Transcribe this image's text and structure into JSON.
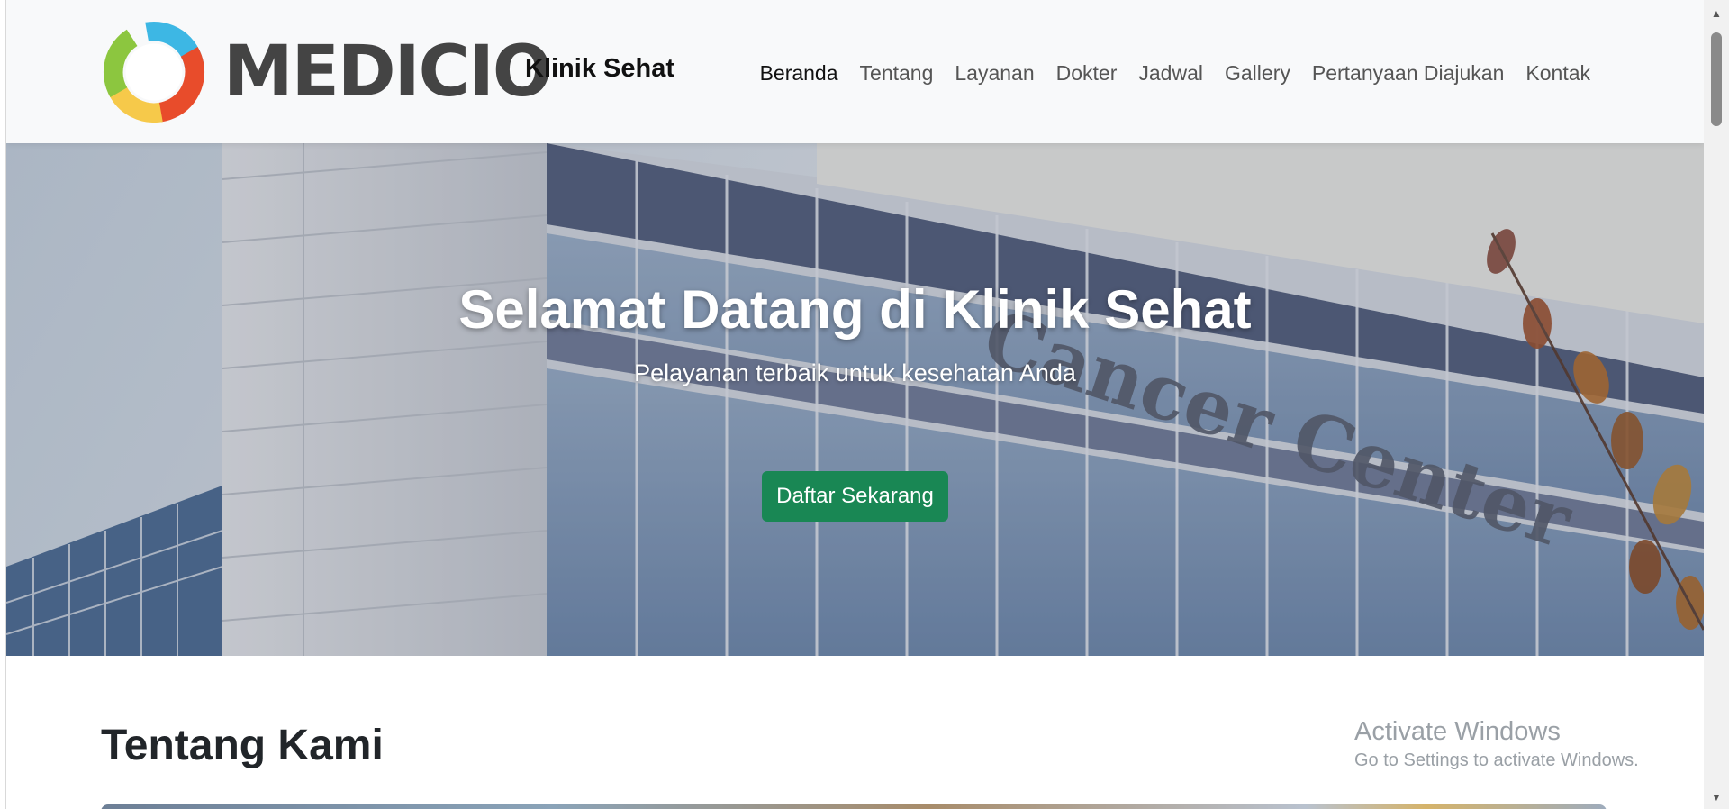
{
  "brand": {
    "logo_word": "MEDICIO",
    "name": "Klinik Sehat"
  },
  "nav": {
    "items": [
      {
        "label": "Beranda",
        "active": true
      },
      {
        "label": "Tentang"
      },
      {
        "label": "Layanan"
      },
      {
        "label": "Dokter"
      },
      {
        "label": "Jadwal"
      },
      {
        "label": "Gallery"
      },
      {
        "label": "Pertanyaan Diajukan"
      },
      {
        "label": "Kontak"
      }
    ]
  },
  "hero": {
    "title": "Selamat Datang di Klinik Sehat",
    "subtitle": "Pelayanan terbaik untuk kesehatan Anda",
    "cta_label": "Daftar Sekarang",
    "background_sign_text": "Cancer Center"
  },
  "about": {
    "title": "Tentang Kami"
  },
  "watermark": {
    "title": "Activate Windows",
    "subtitle": "Go to Settings to activate Windows."
  },
  "colors": {
    "primary_button": "#198754",
    "navbar_bg": "#f8f9fa",
    "logo_ring": [
      "#e84c2b",
      "#f6c94a",
      "#8cc63f",
      "#3db7e4"
    ]
  }
}
